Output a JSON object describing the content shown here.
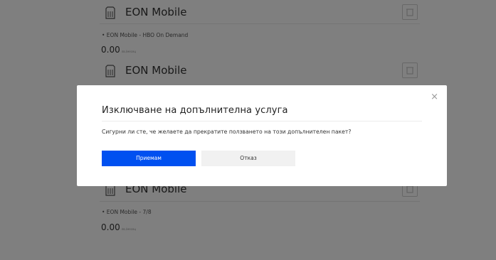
{
  "services": [
    {
      "name": "EON Mobile",
      "detail": "",
      "price": ""
    },
    {
      "name": "EON Mobile",
      "detail": "• EON Mobile - HBO On Demand",
      "price": "0.00",
      "price_unit": "лв./месец"
    },
    {
      "name": "EON Mobile",
      "detail": "",
      "price": ""
    },
    {
      "name": "EON Mobile",
      "detail": "• EON Mobile - 7/8",
      "price": "0.00",
      "price_unit": "лв./месец"
    }
  ],
  "modal": {
    "close_glyph": "×",
    "title": "Изключване на допълнителна услуга",
    "message": "Сигурни ли сте, че желаете да прекратите ползването на този допълнителен пакет?",
    "accept_label": "Приемам",
    "cancel_label": "Отказ"
  },
  "colors": {
    "accent": "#0050f0",
    "overlay": "rgba(0,0,0,0.5)",
    "cancel_bg": "#f1f1f1"
  },
  "icons": {
    "service_icon": "sim-card-icon",
    "delete_icon": "trash-icon"
  }
}
